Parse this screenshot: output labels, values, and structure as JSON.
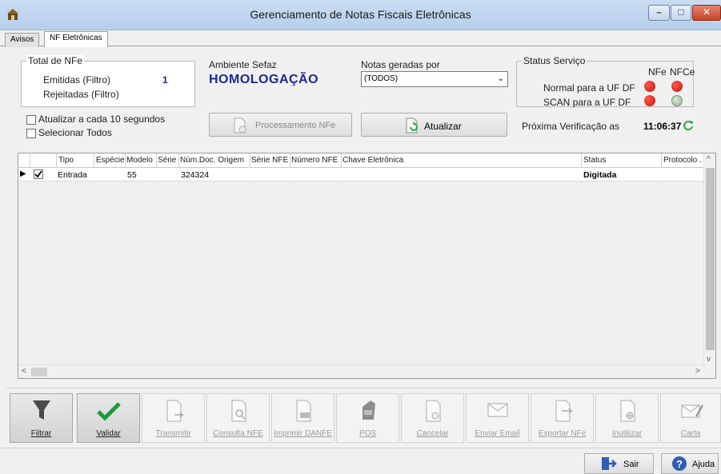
{
  "window": {
    "title": "Gerenciamento de Notas Fiscais Eletrônicas",
    "min": "–",
    "max": "□",
    "close": "✕"
  },
  "tabs": [
    {
      "label": "Avisos"
    },
    {
      "label": "NF Eletrônicas"
    }
  ],
  "total": {
    "legend": "Total de NFe",
    "emitidas_label": "Emitidas (Filtro)",
    "emitidas_value": "1",
    "rejeitadas_label": "Rejeitadas (Filtro)"
  },
  "ambiente": {
    "label": "Ambiente Sefaz",
    "value": "HOMOLOGAÇÃO"
  },
  "notas": {
    "label": "Notas geradas por",
    "selected": "(TODOS)"
  },
  "status": {
    "legend": "Status Serviço",
    "col_nfe": "NFe",
    "col_nfce": "NFCe",
    "normal_label": "Normal para a UF DF",
    "scan_label": "SCAN para a UF DF",
    "next_label": "Próxima Verificação as",
    "next_time": "11:06:37"
  },
  "options": {
    "atualizar": "Atualizar a cada 10 segundos",
    "selecionar": "Selecionar Todos"
  },
  "buttons": {
    "processamento": "Processamento NFe",
    "atualizar": "Atualizar"
  },
  "grid": {
    "columns": [
      "Tipo",
      "Espécie",
      "Modelo",
      "Série",
      "Núm.Doc. Origem",
      "Série NFE",
      "Número NFE",
      "Chave Eletrônica",
      "Status",
      "Protocolo ."
    ],
    "row": {
      "tipo": "Entrada",
      "modelo": "55",
      "num_doc": "324324",
      "status": "Digitada"
    }
  },
  "toolbar": [
    "Filtrar",
    "Validar",
    "Transmitir",
    "Consulta NFE",
    "Imprimir DANFE",
    "POS",
    "Cancelar",
    "Enviar Email",
    "Exportar NFe",
    "Inutilizar",
    "Carta"
  ],
  "footer": {
    "sair": "Sair",
    "ajuda": "Ajuda"
  },
  "colors": {
    "accent": "#1a2a8c",
    "status_red": "#d8140c",
    "status_grey": "#bccbb9",
    "check_green": "#1a9a3a",
    "refresh_green": "#2aa84a"
  }
}
